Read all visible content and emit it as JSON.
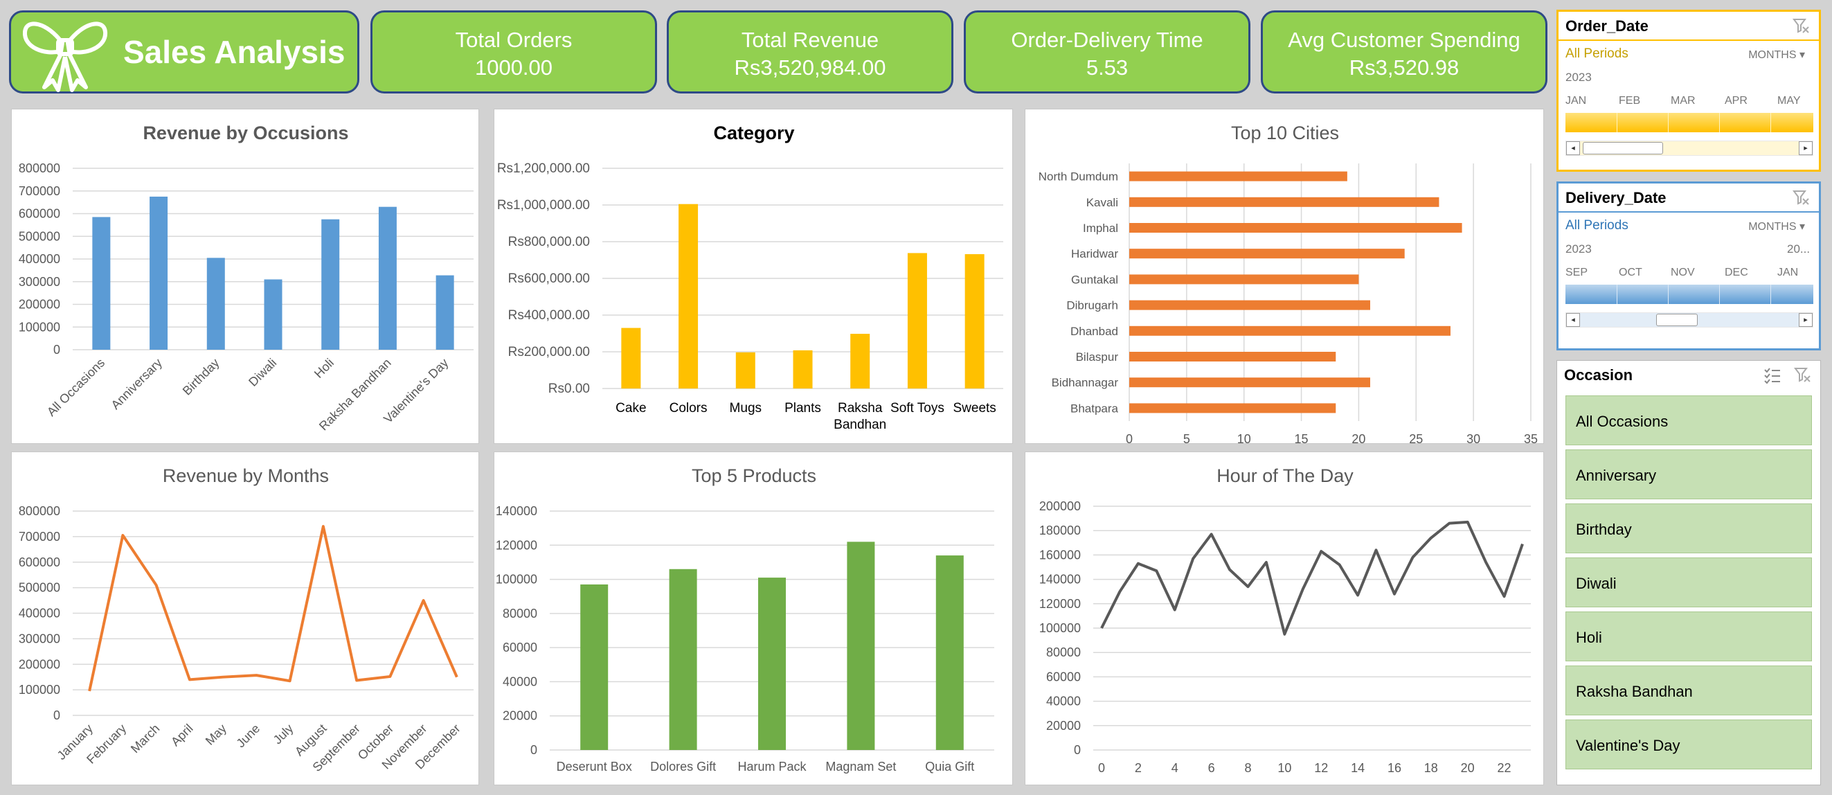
{
  "header": {
    "title": "Sales Analysis",
    "kpis": [
      {
        "label": "Total Orders",
        "value": "1000.00"
      },
      {
        "label": "Total Revenue",
        "value": "Rs3,520,984.00"
      },
      {
        "label": "Order-Delivery Time",
        "value": "5.53"
      },
      {
        "label": "Avg Customer Spending",
        "value": "Rs3,520.98"
      }
    ]
  },
  "chart_data": [
    {
      "id": "occ",
      "type": "bar",
      "title": "Revenue by Occusions",
      "categories": [
        "All Occasions",
        "Anniversary",
        "Birthday",
        "Diwali",
        "Holi",
        "Raksha Bandhan",
        "Valentine's Day"
      ],
      "values": [
        585000,
        675000,
        405000,
        310000,
        575000,
        630000,
        328000
      ],
      "ylim": [
        0,
        800000
      ],
      "yticks": [
        "0",
        "100000",
        "200000",
        "300000",
        "400000",
        "500000",
        "600000",
        "700000",
        "800000"
      ],
      "color": "#5b9bd5"
    },
    {
      "id": "cat",
      "type": "bar",
      "title": "Category",
      "categories": [
        "Cake",
        "Colors",
        "Mugs",
        "Plants",
        "Raksha Bandhan",
        "Soft Toys",
        "Sweets"
      ],
      "values": [
        330000,
        1005000,
        197000,
        208000,
        298000,
        738000,
        732000
      ],
      "ylim": [
        0,
        1200000
      ],
      "yticks": [
        "Rs0.00",
        "Rs200,000.00",
        "Rs400,000.00",
        "Rs600,000.00",
        "Rs800,000.00",
        "Rs1,000,000.00",
        "Rs1,200,000.00"
      ],
      "color": "#ffc000"
    },
    {
      "id": "cities",
      "type": "bar",
      "orientation": "horizontal",
      "title": "Top 10 Cities",
      "categories": [
        "North Dumdum",
        "Kavali",
        "Imphal",
        "Haridwar",
        "Guntakal",
        "Dibrugarh",
        "Dhanbad",
        "Bilaspur",
        "Bidhannagar",
        "Bhatpara"
      ],
      "values": [
        19,
        27,
        29,
        24,
        20,
        21,
        28,
        18,
        21,
        18
      ],
      "xlim": [
        0,
        35
      ],
      "xticks": [
        "0",
        "5",
        "10",
        "15",
        "20",
        "25",
        "30",
        "35"
      ],
      "color": "#ed7d31"
    },
    {
      "id": "months",
      "type": "line",
      "title": "Revenue by Months",
      "categories": [
        "January",
        "February",
        "March",
        "April",
        "May",
        "June",
        "July",
        "August",
        "September",
        "October",
        "November",
        "December"
      ],
      "values": [
        95000,
        705000,
        510000,
        140000,
        150000,
        157000,
        135000,
        740000,
        137000,
        152000,
        450000,
        150000
      ],
      "ylim": [
        0,
        800000
      ],
      "yticks": [
        "0",
        "100000",
        "200000",
        "300000",
        "400000",
        "500000",
        "600000",
        "700000",
        "800000"
      ],
      "color": "#ed7d31"
    },
    {
      "id": "products",
      "type": "bar",
      "title": "Top 5 Products",
      "categories": [
        "Deserunt Box",
        "Dolores Gift",
        "Harum Pack",
        "Magnam Set",
        "Quia Gift"
      ],
      "values": [
        97000,
        106000,
        101000,
        122000,
        114000
      ],
      "ylim": [
        0,
        140000
      ],
      "yticks": [
        "0",
        "20000",
        "40000",
        "60000",
        "80000",
        "100000",
        "120000",
        "140000"
      ],
      "color": "#70ad47"
    },
    {
      "id": "hours",
      "type": "line",
      "title": "Hour of The Day",
      "x": [
        0,
        1,
        2,
        3,
        4,
        5,
        6,
        7,
        8,
        9,
        10,
        11,
        12,
        13,
        14,
        15,
        16,
        17,
        18,
        19,
        20,
        21,
        22,
        23
      ],
      "values": [
        100000,
        130000,
        153000,
        147000,
        115000,
        157000,
        177000,
        148000,
        134000,
        154000,
        95000,
        132000,
        163000,
        152000,
        127000,
        164000,
        128000,
        158000,
        174000,
        186000,
        187000,
        154000,
        126000,
        169000
      ],
      "ylim": [
        0,
        200000
      ],
      "yticks": [
        "0",
        "20000",
        "40000",
        "60000",
        "80000",
        "100000",
        "120000",
        "140000",
        "160000",
        "180000",
        "200000"
      ],
      "xticks": [
        "0",
        "2",
        "4",
        "6",
        "8",
        "10",
        "12",
        "14",
        "16",
        "18",
        "20",
        "22"
      ],
      "color": "#595959"
    }
  ],
  "slicers": {
    "order_date": {
      "title": "Order_Date",
      "period": "All Periods",
      "level": "MONTHS",
      "year": "2023",
      "months": [
        "JAN",
        "FEB",
        "MAR",
        "APR",
        "MAY"
      ],
      "accent": "#ffc000"
    },
    "delivery_date": {
      "title": "Delivery_Date",
      "period": "All Periods",
      "level": "MONTHS",
      "year": "2023",
      "year_next": "20...",
      "months": [
        "SEP",
        "OCT",
        "NOV",
        "DEC",
        "JAN"
      ],
      "accent": "#5b9bd5"
    },
    "occasion": {
      "title": "Occasion",
      "items": [
        "All Occasions",
        "Anniversary",
        "Birthday",
        "Diwali",
        "Holi",
        "Raksha Bandhan",
        "Valentine's Day"
      ]
    }
  }
}
